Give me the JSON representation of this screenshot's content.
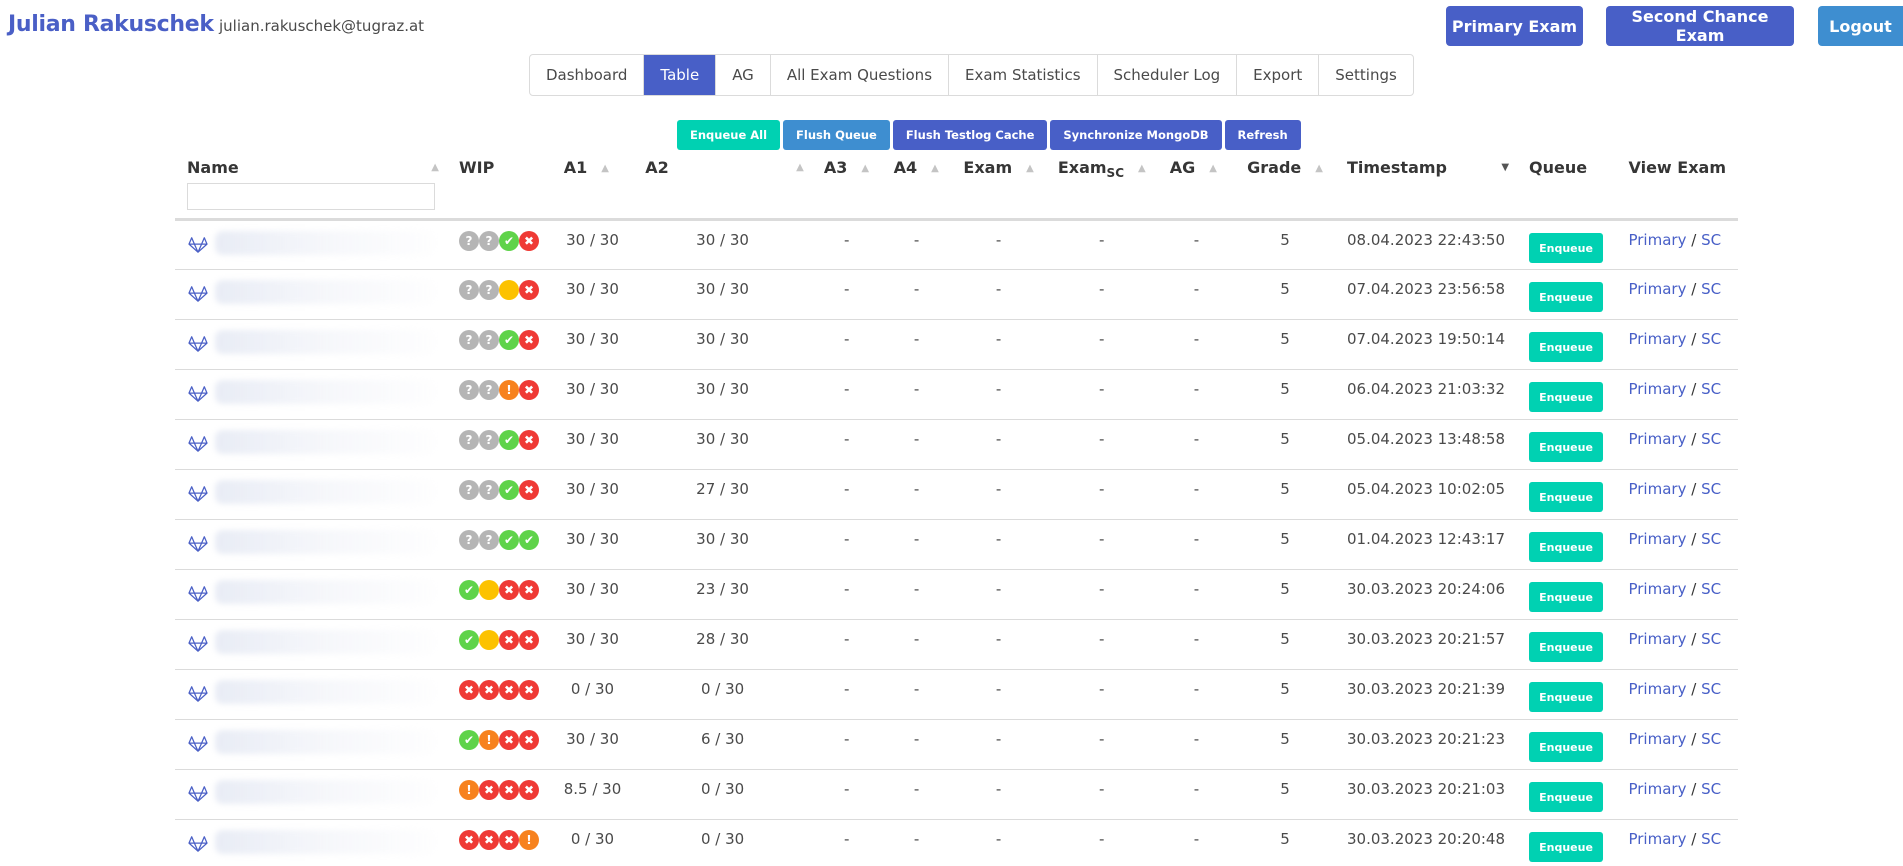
{
  "header": {
    "user_name": "Julian Rakuschek",
    "email": "julian.rakuschek@tugraz.at",
    "buttons": {
      "primary_exam": "Primary Exam",
      "second_chance_exam": "Second Chance Exam",
      "logout": "Logout"
    }
  },
  "tabs": [
    {
      "label": "Dashboard",
      "active": false
    },
    {
      "label": "Table",
      "active": true
    },
    {
      "label": "AG",
      "active": false
    },
    {
      "label": "All Exam Questions",
      "active": false
    },
    {
      "label": "Exam Statistics",
      "active": false
    },
    {
      "label": "Scheduler Log",
      "active": false
    },
    {
      "label": "Export",
      "active": false
    },
    {
      "label": "Settings",
      "active": false
    }
  ],
  "actions": {
    "enqueue_all": "Enqueue All",
    "flush_queue": "Flush Queue",
    "flush_testlog_cache": "Flush Testlog Cache",
    "synchronize_mongodb": "Synchronize MongoDB",
    "refresh": "Refresh"
  },
  "table": {
    "columns": {
      "name": "Name",
      "wip": "WIP",
      "a1": "A1",
      "a2": "A2",
      "a3": "A3",
      "a4": "A4",
      "exam": "Exam",
      "exam_sc_base": "Exam",
      "exam_sc_sub": "SC",
      "ag": "AG",
      "grade": "Grade",
      "timestamp": "Timestamp",
      "queue": "Queue",
      "view_exam": "View Exam"
    },
    "name_filter_value": "",
    "enqueue_label": "Enqueue",
    "view_primary_label": "Primary",
    "view_separator": "/",
    "view_sc_label": "SC",
    "rows": [
      {
        "wip": [
          "unknown",
          "unknown",
          "pass",
          "fail"
        ],
        "a1": "30 / 30",
        "a2": "30 / 30",
        "a3": "-",
        "a4": "-",
        "exam": "-",
        "exam_sc": "-",
        "ag": "-",
        "grade": "5",
        "timestamp": "08.04.2023 22:43:50"
      },
      {
        "wip": [
          "unknown",
          "unknown",
          "pending",
          "fail"
        ],
        "a1": "30 / 30",
        "a2": "30 / 30",
        "a3": "-",
        "a4": "-",
        "exam": "-",
        "exam_sc": "-",
        "ag": "-",
        "grade": "5",
        "timestamp": "07.04.2023 23:56:58"
      },
      {
        "wip": [
          "unknown",
          "unknown",
          "pass",
          "fail"
        ],
        "a1": "30 / 30",
        "a2": "30 / 30",
        "a3": "-",
        "a4": "-",
        "exam": "-",
        "exam_sc": "-",
        "ag": "-",
        "grade": "5",
        "timestamp": "07.04.2023 19:50:14"
      },
      {
        "wip": [
          "unknown",
          "unknown",
          "warn",
          "fail"
        ],
        "a1": "30 / 30",
        "a2": "30 / 30",
        "a3": "-",
        "a4": "-",
        "exam": "-",
        "exam_sc": "-",
        "ag": "-",
        "grade": "5",
        "timestamp": "06.04.2023 21:03:32"
      },
      {
        "wip": [
          "unknown",
          "unknown",
          "pass",
          "fail"
        ],
        "a1": "30 / 30",
        "a2": "30 / 30",
        "a3": "-",
        "a4": "-",
        "exam": "-",
        "exam_sc": "-",
        "ag": "-",
        "grade": "5",
        "timestamp": "05.04.2023 13:48:58"
      },
      {
        "wip": [
          "unknown",
          "unknown",
          "pass",
          "fail"
        ],
        "a1": "30 / 30",
        "a2": "27 / 30",
        "a3": "-",
        "a4": "-",
        "exam": "-",
        "exam_sc": "-",
        "ag": "-",
        "grade": "5",
        "timestamp": "05.04.2023 10:02:05"
      },
      {
        "wip": [
          "unknown",
          "unknown",
          "pass",
          "pass"
        ],
        "a1": "30 / 30",
        "a2": "30 / 30",
        "a3": "-",
        "a4": "-",
        "exam": "-",
        "exam_sc": "-",
        "ag": "-",
        "grade": "5",
        "timestamp": "01.04.2023 12:43:17"
      },
      {
        "wip": [
          "pass",
          "pending",
          "fail",
          "fail"
        ],
        "a1": "30 / 30",
        "a2": "23 / 30",
        "a3": "-",
        "a4": "-",
        "exam": "-",
        "exam_sc": "-",
        "ag": "-",
        "grade": "5",
        "timestamp": "30.03.2023 20:24:06"
      },
      {
        "wip": [
          "pass",
          "pending",
          "fail",
          "fail"
        ],
        "a1": "30 / 30",
        "a2": "28 / 30",
        "a3": "-",
        "a4": "-",
        "exam": "-",
        "exam_sc": "-",
        "ag": "-",
        "grade": "5",
        "timestamp": "30.03.2023 20:21:57"
      },
      {
        "wip": [
          "fail",
          "fail",
          "fail",
          "fail"
        ],
        "a1": "0 / 30",
        "a2": "0 / 30",
        "a3": "-",
        "a4": "-",
        "exam": "-",
        "exam_sc": "-",
        "ag": "-",
        "grade": "5",
        "timestamp": "30.03.2023 20:21:39"
      },
      {
        "wip": [
          "pass",
          "warn",
          "fail",
          "fail"
        ],
        "a1": "30 / 30",
        "a2": "6 / 30",
        "a3": "-",
        "a4": "-",
        "exam": "-",
        "exam_sc": "-",
        "ag": "-",
        "grade": "5",
        "timestamp": "30.03.2023 20:21:23"
      },
      {
        "wip": [
          "warn",
          "fail",
          "fail",
          "fail"
        ],
        "a1": "8.5 / 30",
        "a2": "0 / 30",
        "a3": "-",
        "a4": "-",
        "exam": "-",
        "exam_sc": "-",
        "ag": "-",
        "grade": "5",
        "timestamp": "30.03.2023 20:21:03"
      },
      {
        "wip": [
          "fail",
          "fail",
          "fail",
          "warn"
        ],
        "a1": "0 / 30",
        "a2": "0 / 30",
        "a3": "-",
        "a4": "-",
        "exam": "-",
        "exam_sc": "-",
        "ag": "-",
        "grade": "5",
        "timestamp": "30.03.2023 20:20:48"
      }
    ]
  },
  "icons": {
    "sort_asc": "▲",
    "sort_desc": "▼",
    "status_glyphs": {
      "unknown": "?",
      "pass": "✔",
      "fail": "✖",
      "warn": "!",
      "pending": ""
    }
  },
  "colors": {
    "brand": "#485fc7",
    "info": "#3e8ed0",
    "teal": "#00d1b2",
    "pass": "#5fd34a",
    "fail": "#ef3a35",
    "warn": "#f7821e",
    "pending": "#fcc200",
    "unknown": "#b5b5b5"
  }
}
